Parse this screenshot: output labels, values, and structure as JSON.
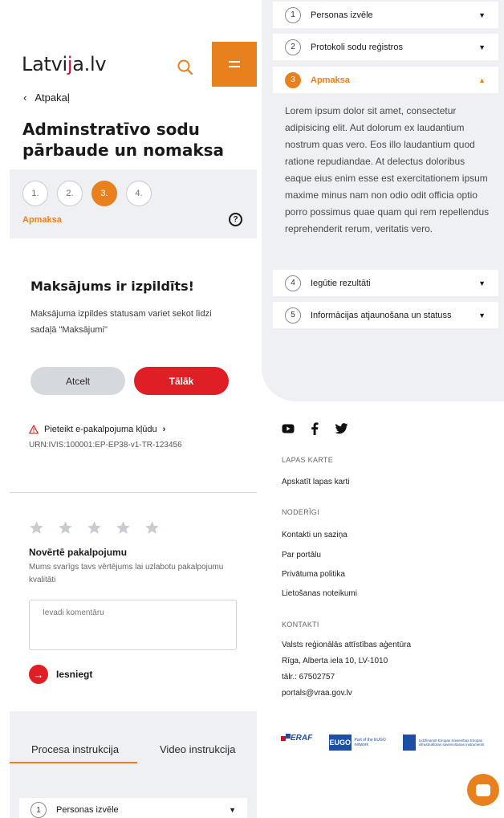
{
  "header": {
    "logo_main": "Latvi",
    "logo_j": "j",
    "logo_rest": "a.lv",
    "back_label": "Atpakaļ"
  },
  "page": {
    "title": "Adminstratīvo sodu pārbaude un nomaksa"
  },
  "steps": {
    "items": [
      "1.",
      "2.",
      "3.",
      "4."
    ],
    "active_index": 2,
    "active_label": "Apmaksa",
    "help_icon": "?"
  },
  "result": {
    "title": "Maksājums ir izpildīts!",
    "text": "Maksājuma izpildes statusam variet sekot līdzi sadaļā \"Maksājumi\"",
    "cancel_label": "Atcelt",
    "next_label": "Tālāk"
  },
  "report": {
    "label": "Pieteikt e-pakalpojuma kļūdu",
    "urn": "URN:IVIS:100001:EP-EP38-v1-TR-123456"
  },
  "rating": {
    "stars": 5,
    "selected": 0,
    "title": "Novērtē pakalpojumu",
    "text": "Mums svarīgs tavs vērtējums lai uzlabotu pakalpojumu kvalitāti",
    "comment_placeholder": "Ievadi komentāru",
    "submit_label": "Iesniegt"
  },
  "instructions": {
    "tabs": [
      "Procesa instrukcija",
      "Video instrukcija"
    ],
    "active_tab": 0,
    "first_item_num": "1",
    "first_item_label": "Personas izvēle"
  },
  "accordion": {
    "items": [
      {
        "num": "1",
        "label": "Personas izvēle"
      },
      {
        "num": "2",
        "label": "Protokoli sodu reģistros"
      },
      {
        "num": "3",
        "label": "Apmaksa"
      },
      {
        "num": "4",
        "label": "Iegūtie rezultāti"
      },
      {
        "num": "5",
        "label": "Informācijas atjaunošana un statuss"
      }
    ],
    "open_index": 2,
    "body": "Lorem ipsum dolor sit amet, consectetur adipisicing elit. Aut dolorum ex laudantium nostrum quas vero. Eos illo laudantium quod ratione repudiandae. At delectus doloribus eaque eius enim esse est exercitationem ipsum maxime minus nam non odio odit officia optio porro possimus quae quam qui rem repellendus reprehenderit rerum, veritatis vero."
  },
  "footer": {
    "social": [
      "youtube-icon",
      "facebook-icon",
      "twitter-icon"
    ],
    "sitemap_heading": "LAPAS KARTE",
    "sitemap_link": "Apskatīt lapas karti",
    "useful_heading": "NODERĪGI",
    "useful_links": [
      "Kontakti un saziņa",
      "Par portālu",
      "Privātuma politika",
      "Lietošanas noteikumi"
    ],
    "contacts_heading": "KONTAKTI",
    "contacts": [
      "Valsts reģionālās attīstības aģentūra",
      "Rīga, Alberta iela 10, LV-1010",
      "tālr.: 67502757",
      "portals@vraa.gov.lv"
    ],
    "partner_eraf": "ERAF",
    "partner_eugo": "EUGO",
    "partner_eugo_text": "Part of the EUGO network",
    "partner_eu_text": "Līdzfinansē Eiropas Savienības Eiropas infrastruktūras savienošanas instruments"
  },
  "colors": {
    "accent_orange": "#e8801e",
    "accent_red": "#e01e25",
    "panel_grey": "#eef0f3"
  }
}
